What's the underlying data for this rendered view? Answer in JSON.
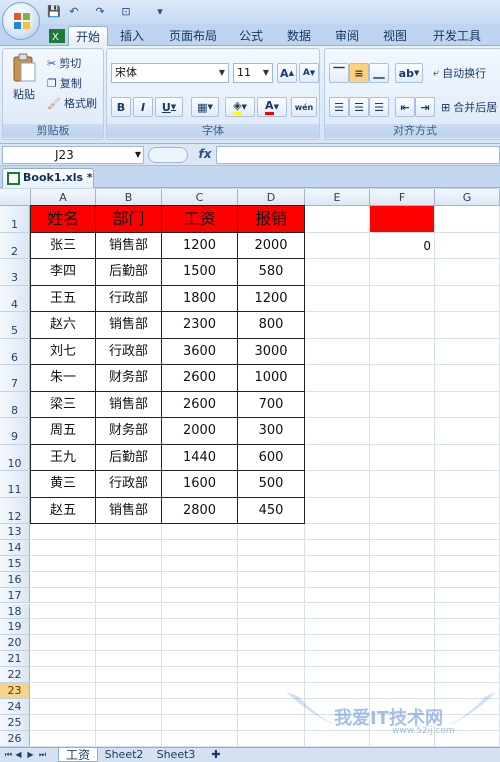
{
  "qat": {
    "save": "💾",
    "undo": "↶",
    "redo": "↷",
    "preview": "⊡",
    "customize": "▾"
  },
  "tabs": [
    "开始",
    "插入",
    "页面布局",
    "公式",
    "数据",
    "审阅",
    "视图",
    "开发工具"
  ],
  "ribbon": {
    "clipboard": {
      "label": "剪贴板",
      "paste": "粘贴",
      "cut": "剪切",
      "copy": "复制",
      "format_painter": "格式刷"
    },
    "font": {
      "label": "字体",
      "font_name": "宋体",
      "font_size": "11",
      "grow": "A",
      "shrink": "A",
      "bold": "B",
      "italic": "I",
      "underline": "U",
      "wen": "wén"
    },
    "alignment": {
      "label": "对齐方式",
      "wrap": "自动换行",
      "merge": "合并后居"
    }
  },
  "formula_bar": {
    "name_box": "J23",
    "fx": "fx",
    "formula": ""
  },
  "workbook_tab": "Book1.xls *",
  "columns": [
    "A",
    "B",
    "C",
    "D",
    "E",
    "F",
    "G"
  ],
  "table": {
    "headers": [
      "姓名",
      "部门",
      "工资",
      "报销"
    ],
    "rows": [
      [
        "张三",
        "销售部",
        "1200",
        "2000"
      ],
      [
        "李四",
        "后勤部",
        "1500",
        "580"
      ],
      [
        "王五",
        "行政部",
        "1800",
        "1200"
      ],
      [
        "赵六",
        "销售部",
        "2300",
        "800"
      ],
      [
        "刘七",
        "行政部",
        "3600",
        "3000"
      ],
      [
        "朱一",
        "财务部",
        "2600",
        "1000"
      ],
      [
        "梁三",
        "销售部",
        "2600",
        "700"
      ],
      [
        "周五",
        "财务部",
        "2000",
        "300"
      ],
      [
        "王九",
        "后勤部",
        "1440",
        "600"
      ],
      [
        "黄三",
        "行政部",
        "1600",
        "500"
      ],
      [
        "赵五",
        "销售部",
        "2800",
        "450"
      ]
    ]
  },
  "f2_value": "0",
  "row_numbers": [
    "1",
    "2",
    "3",
    "4",
    "5",
    "6",
    "7",
    "8",
    "9",
    "10",
    "11",
    "12",
    "13",
    "14",
    "15",
    "16",
    "17",
    "18",
    "19",
    "20",
    "21",
    "22",
    "23",
    "24",
    "25",
    "26"
  ],
  "selected_row": "23",
  "sheet_tabs": [
    "工资",
    "Sheet2",
    "Sheet3"
  ],
  "colors": {
    "header_fill": "#ff0000",
    "selected_row": "#f8d48a",
    "tab_bar": "#bfd4ee"
  },
  "watermark": {
    "text": "我爱IT技术网",
    "url": "www.52ij.com"
  }
}
